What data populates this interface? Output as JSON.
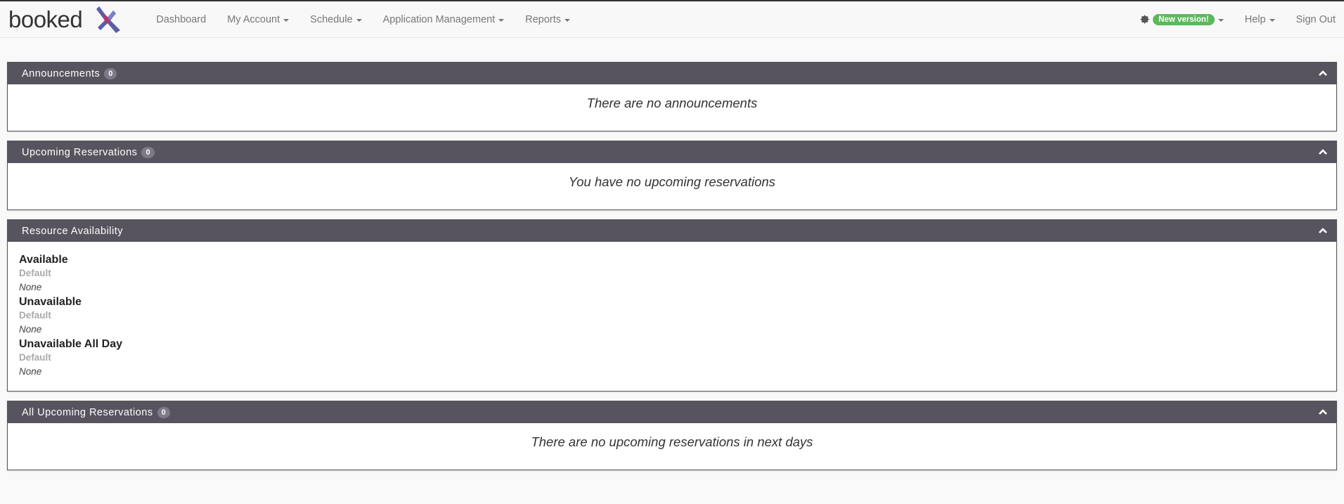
{
  "brand": {
    "name": "booked",
    "logo_icon": "booked-logo-icon"
  },
  "nav": {
    "left": [
      {
        "label": "Dashboard",
        "dropdown": false
      },
      {
        "label": "My Account",
        "dropdown": true
      },
      {
        "label": "Schedule",
        "dropdown": true
      },
      {
        "label": "Application Management",
        "dropdown": true
      },
      {
        "label": "Reports",
        "dropdown": true
      }
    ],
    "right": {
      "new_version_label": "New version!",
      "help_label": "Help",
      "signout_label": "Sign Out"
    }
  },
  "panels": {
    "announcements": {
      "title": "Announcements",
      "count": "0",
      "empty_text": "There are no announcements"
    },
    "upcoming": {
      "title": "Upcoming Reservations",
      "count": "0",
      "empty_text": "You have no upcoming reservations"
    },
    "availability": {
      "title": "Resource Availability",
      "groups": [
        {
          "title": "Available",
          "schedule": "Default",
          "value": "None"
        },
        {
          "title": "Unavailable",
          "schedule": "Default",
          "value": "None"
        },
        {
          "title": "Unavailable All Day",
          "schedule": "Default",
          "value": "None"
        }
      ]
    },
    "all_upcoming": {
      "title": "All Upcoming Reservations",
      "count": "0",
      "empty_text": "There are no upcoming reservations in next days"
    }
  },
  "colors": {
    "panel_heading": "#58545f",
    "badge_green": "#5cb85c",
    "count_badge": "#7e7888"
  }
}
